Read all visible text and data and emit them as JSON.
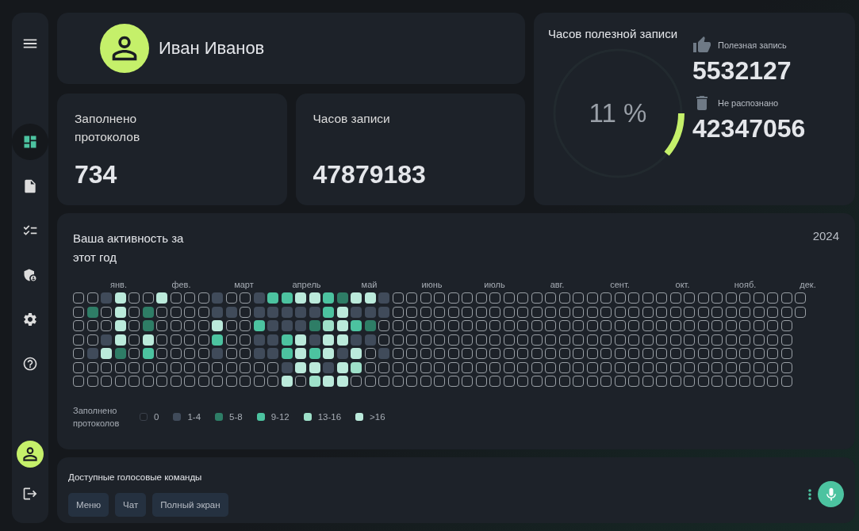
{
  "sidebar": {
    "items": [
      {
        "selected": true
      },
      {
        "selected": false
      },
      {
        "selected": false
      },
      {
        "selected": false
      },
      {
        "selected": false
      },
      {
        "selected": false
      }
    ]
  },
  "profile": {
    "name": "Иван Иванов"
  },
  "stats": [
    {
      "label": "Заполнено протоколов",
      "value": "734"
    },
    {
      "label": "Часов записи",
      "value": "47879183"
    }
  ],
  "useful": {
    "title": "Часов полезной записи",
    "level": 0.11,
    "percent": "11 %",
    "items": [
      {
        "kind": "useful",
        "label": "Полезная запись",
        "value": "5532127"
      },
      {
        "kind": "unrecognized",
        "label": "Не распознано",
        "value": "42347056"
      }
    ]
  },
  "activity": {
    "title": "Ваша активность за этот год",
    "year": "2024",
    "months": [
      "янв.",
      "фев.",
      "март",
      "апрель",
      "май",
      "июнь",
      "июль",
      "авг.",
      "сент.",
      "окт.",
      "нояб.",
      "дек."
    ],
    "rows": [
      [
        {
          "color": "#1b1f25"
        },
        {
          "color": "#1b1f25"
        },
        {
          "color": "#404b5a"
        },
        {
          "color": "#bbeadb"
        },
        {
          "color": "#1b1f25"
        },
        {
          "color": "#1b1f25"
        },
        {
          "color": "#bbeadb"
        },
        {
          "color": "#1b1f25"
        },
        {
          "color": "#1b1f25"
        },
        {
          "color": "#1b1f25"
        },
        {
          "color": "#404b5a"
        },
        {
          "color": "#1b1f25"
        },
        {
          "color": "#1b1f25"
        },
        {
          "color": "#404b5a"
        },
        {
          "color": "#4cc3a0"
        },
        {
          "color": "#4cc3a0"
        },
        {
          "color": "#bbeadb"
        },
        {
          "color": "#bbeadb"
        },
        {
          "color": "#4cc3a0"
        },
        {
          "color": "#2e7d66"
        },
        {
          "color": "#bbeadb"
        },
        {
          "color": "#bbeadb"
        },
        {
          "color": "#404b5a"
        },
        {
          "color": "#1b1f25"
        },
        {
          "color": "#1b1f25"
        },
        {
          "color": "#1b1f25"
        },
        {
          "color": "#1b1f25"
        },
        {
          "color": "#1b1f25"
        },
        {
          "color": "#1b1f25"
        },
        {
          "color": "#1b1f25"
        },
        {
          "color": "#1b1f25"
        },
        {
          "color": "#1b1f25"
        },
        {
          "color": "#1b1f25"
        },
        {
          "color": "#1b1f25"
        },
        {
          "color": "#1b1f25"
        },
        {
          "color": "#1b1f25"
        },
        {
          "color": "#1b1f25"
        },
        {
          "color": "#1b1f25"
        },
        {
          "color": "#1b1f25"
        },
        {
          "color": "#1b1f25"
        },
        {
          "color": "#1b1f25"
        },
        {
          "color": "#1b1f25"
        },
        {
          "color": "#1b1f25"
        },
        {
          "color": "#1b1f25"
        },
        {
          "color": "#1b1f25"
        },
        {
          "color": "#1b1f25"
        },
        {
          "color": "#1b1f25"
        },
        {
          "color": "#1b1f25"
        },
        {
          "color": "#1b1f25"
        },
        {
          "color": "#1b1f25"
        },
        {
          "color": "#1b1f25"
        },
        {
          "color": "#1b1f25"
        },
        {
          "color": "#1b1f25"
        }
      ],
      [
        {
          "color": "#1b1f25"
        },
        {
          "color": "#2e7d66"
        },
        {
          "color": "#1b1f25"
        },
        {
          "color": "#bbeadb"
        },
        {
          "color": "#1b1f25"
        },
        {
          "color": "#2e7d66"
        },
        {
          "color": "#1b1f25"
        },
        {
          "color": "#1b1f25"
        },
        {
          "color": "#1b1f25"
        },
        {
          "color": "#1b1f25"
        },
        {
          "color": "#404b5a"
        },
        {
          "color": "#404b5a"
        },
        {
          "color": "#1b1f25"
        },
        {
          "color": "#404b5a"
        },
        {
          "color": "#404b5a"
        },
        {
          "color": "#404b5a"
        },
        {
          "color": "#404b5a"
        },
        {
          "color": "#404b5a"
        },
        {
          "color": "#4cc3a0"
        },
        {
          "color": "#bbeadb"
        },
        {
          "color": "#404b5a"
        },
        {
          "color": "#404b5a"
        },
        {
          "color": "#404b5a"
        },
        {
          "color": "#1b1f25"
        },
        {
          "color": "#1b1f25"
        },
        {
          "color": "#1b1f25"
        },
        {
          "color": "#1b1f25"
        },
        {
          "color": "#1b1f25"
        },
        {
          "color": "#1b1f25"
        },
        {
          "color": "#1b1f25"
        },
        {
          "color": "#1b1f25"
        },
        {
          "color": "#1b1f25"
        },
        {
          "color": "#1b1f25"
        },
        {
          "color": "#1b1f25"
        },
        {
          "color": "#1b1f25"
        },
        {
          "color": "#1b1f25"
        },
        {
          "color": "#1b1f25"
        },
        {
          "color": "#1b1f25"
        },
        {
          "color": "#1b1f25"
        },
        {
          "color": "#1b1f25"
        },
        {
          "color": "#1b1f25"
        },
        {
          "color": "#1b1f25"
        },
        {
          "color": "#1b1f25"
        },
        {
          "color": "#1b1f25"
        },
        {
          "color": "#1b1f25"
        },
        {
          "color": "#1b1f25"
        },
        {
          "color": "#1b1f25"
        },
        {
          "color": "#1b1f25"
        },
        {
          "color": "#1b1f25"
        },
        {
          "color": "#1b1f25"
        },
        {
          "color": "#1b1f25"
        },
        {
          "color": "#1b1f25"
        },
        {
          "color": "#1b1f25"
        }
      ],
      [
        {
          "color": "#1b1f25"
        },
        {
          "color": "#1b1f25"
        },
        {
          "color": "#1b1f25"
        },
        {
          "color": "#bbeadb"
        },
        {
          "color": "#1b1f25"
        },
        {
          "color": "#2e7d66"
        },
        {
          "color": "#1b1f25"
        },
        {
          "color": "#1b1f25"
        },
        {
          "color": "#1b1f25"
        },
        {
          "color": "#1b1f25"
        },
        {
          "color": "#bbeadb"
        },
        {
          "color": "#1b1f25"
        },
        {
          "color": "#1b1f25"
        },
        {
          "color": "#4cc3a0"
        },
        {
          "color": "#404b5a"
        },
        {
          "color": "#404b5a"
        },
        {
          "color": "#404b5a"
        },
        {
          "color": "#2e7d66"
        },
        {
          "color": "#9ee0c9"
        },
        {
          "color": "#bbeadb"
        },
        {
          "color": "#4cc3a0"
        },
        {
          "color": "#2e7d66"
        },
        {
          "color": "#1b1f25"
        },
        {
          "color": "#1b1f25"
        },
        {
          "color": "#1b1f25"
        },
        {
          "color": "#1b1f25"
        },
        {
          "color": "#1b1f25"
        },
        {
          "color": "#1b1f25"
        },
        {
          "color": "#1b1f25"
        },
        {
          "color": "#1b1f25"
        },
        {
          "color": "#1b1f25"
        },
        {
          "color": "#1b1f25"
        },
        {
          "color": "#1b1f25"
        },
        {
          "color": "#1b1f25"
        },
        {
          "color": "#1b1f25"
        },
        {
          "color": "#1b1f25"
        },
        {
          "color": "#1b1f25"
        },
        {
          "color": "#1b1f25"
        },
        {
          "color": "#1b1f25"
        },
        {
          "color": "#1b1f25"
        },
        {
          "color": "#1b1f25"
        },
        {
          "color": "#1b1f25"
        },
        {
          "color": "#1b1f25"
        },
        {
          "color": "#1b1f25"
        },
        {
          "color": "#1b1f25"
        },
        {
          "color": "#1b1f25"
        },
        {
          "color": "#1b1f25"
        },
        {
          "color": "#1b1f25"
        },
        {
          "color": "#1b1f25"
        },
        {
          "color": "#1b1f25"
        },
        {
          "color": "#1b1f25"
        },
        {
          "color": "#1b1f25"
        }
      ],
      [
        {
          "color": "#1b1f25"
        },
        {
          "color": "#1b1f25"
        },
        {
          "color": "#404b5a"
        },
        {
          "color": "#bbeadb"
        },
        {
          "color": "#1b1f25"
        },
        {
          "color": "#bbeadb"
        },
        {
          "color": "#1b1f25"
        },
        {
          "color": "#1b1f25"
        },
        {
          "color": "#1b1f25"
        },
        {
          "color": "#1b1f25"
        },
        {
          "color": "#4cc3a0"
        },
        {
          "color": "#1b1f25"
        },
        {
          "color": "#1b1f25"
        },
        {
          "color": "#404b5a"
        },
        {
          "color": "#404b5a"
        },
        {
          "color": "#4cc3a0"
        },
        {
          "color": "#bbeadb"
        },
        {
          "color": "#404b5a"
        },
        {
          "color": "#bbeadb"
        },
        {
          "color": "#bbeadb"
        },
        {
          "color": "#404b5a"
        },
        {
          "color": "#404b5a"
        },
        {
          "color": "#1b1f25"
        },
        {
          "color": "#1b1f25"
        },
        {
          "color": "#1b1f25"
        },
        {
          "color": "#1b1f25"
        },
        {
          "color": "#1b1f25"
        },
        {
          "color": "#1b1f25"
        },
        {
          "color": "#1b1f25"
        },
        {
          "color": "#1b1f25"
        },
        {
          "color": "#1b1f25"
        },
        {
          "color": "#1b1f25"
        },
        {
          "color": "#1b1f25"
        },
        {
          "color": "#1b1f25"
        },
        {
          "color": "#1b1f25"
        },
        {
          "color": "#1b1f25"
        },
        {
          "color": "#1b1f25"
        },
        {
          "color": "#1b1f25"
        },
        {
          "color": "#1b1f25"
        },
        {
          "color": "#1b1f25"
        },
        {
          "color": "#1b1f25"
        },
        {
          "color": "#1b1f25"
        },
        {
          "color": "#1b1f25"
        },
        {
          "color": "#1b1f25"
        },
        {
          "color": "#1b1f25"
        },
        {
          "color": "#1b1f25"
        },
        {
          "color": "#1b1f25"
        },
        {
          "color": "#1b1f25"
        },
        {
          "color": "#1b1f25"
        },
        {
          "color": "#1b1f25"
        },
        {
          "color": "#1b1f25"
        },
        {
          "color": "#1b1f25"
        }
      ],
      [
        {
          "color": "#1b1f25"
        },
        {
          "color": "#404b5a"
        },
        {
          "color": "#bbeadb"
        },
        {
          "color": "#2e7d66"
        },
        {
          "color": "#1b1f25"
        },
        {
          "color": "#4cc3a0"
        },
        {
          "color": "#1b1f25"
        },
        {
          "color": "#1b1f25"
        },
        {
          "color": "#1b1f25"
        },
        {
          "color": "#1b1f25"
        },
        {
          "color": "#404b5a"
        },
        {
          "color": "#1b1f25"
        },
        {
          "color": "#1b1f25"
        },
        {
          "color": "#404b5a"
        },
        {
          "color": "#404b5a"
        },
        {
          "color": "#4cc3a0"
        },
        {
          "color": "#bbeadb"
        },
        {
          "color": "#4cc3a0"
        },
        {
          "color": "#bbeadb"
        },
        {
          "color": "#404b5a"
        },
        {
          "color": "#bbeadb"
        },
        {
          "color": "#1b1f25"
        },
        {
          "color": "#404b5a"
        },
        {
          "color": "#1b1f25"
        },
        {
          "color": "#1b1f25"
        },
        {
          "color": "#1b1f25"
        },
        {
          "color": "#1b1f25"
        },
        {
          "color": "#1b1f25"
        },
        {
          "color": "#1b1f25"
        },
        {
          "color": "#1b1f25"
        },
        {
          "color": "#1b1f25"
        },
        {
          "color": "#1b1f25"
        },
        {
          "color": "#1b1f25"
        },
        {
          "color": "#1b1f25"
        },
        {
          "color": "#1b1f25"
        },
        {
          "color": "#1b1f25"
        },
        {
          "color": "#1b1f25"
        },
        {
          "color": "#1b1f25"
        },
        {
          "color": "#1b1f25"
        },
        {
          "color": "#1b1f25"
        },
        {
          "color": "#1b1f25"
        },
        {
          "color": "#1b1f25"
        },
        {
          "color": "#1b1f25"
        },
        {
          "color": "#1b1f25"
        },
        {
          "color": "#1b1f25"
        },
        {
          "color": "#1b1f25"
        },
        {
          "color": "#1b1f25"
        },
        {
          "color": "#1b1f25"
        },
        {
          "color": "#1b1f25"
        },
        {
          "color": "#1b1f25"
        },
        {
          "color": "#1b1f25"
        },
        {
          "color": "#1b1f25"
        }
      ],
      [
        {
          "color": "#1b1f25"
        },
        {
          "color": "#1b1f25"
        },
        {
          "color": "#1b1f25"
        },
        {
          "color": "#1b1f25"
        },
        {
          "color": "#1b1f25"
        },
        {
          "color": "#1b1f25"
        },
        {
          "color": "#1b1f25"
        },
        {
          "color": "#1b1f25"
        },
        {
          "color": "#1b1f25"
        },
        {
          "color": "#1b1f25"
        },
        {
          "color": "#1b1f25"
        },
        {
          "color": "#1b1f25"
        },
        {
          "color": "#1b1f25"
        },
        {
          "color": "#1b1f25"
        },
        {
          "color": "#1b1f25"
        },
        {
          "color": "#404b5a"
        },
        {
          "color": "#bbeadb"
        },
        {
          "color": "#bbeadb"
        },
        {
          "color": "#404b5a"
        },
        {
          "color": "#bbeadb"
        },
        {
          "color": "#9ee0c9"
        },
        {
          "color": "#1b1f25"
        },
        {
          "color": "#1b1f25"
        },
        {
          "color": "#1b1f25"
        },
        {
          "color": "#1b1f25"
        },
        {
          "color": "#1b1f25"
        },
        {
          "color": "#1b1f25"
        },
        {
          "color": "#1b1f25"
        },
        {
          "color": "#1b1f25"
        },
        {
          "color": "#1b1f25"
        },
        {
          "color": "#1b1f25"
        },
        {
          "color": "#1b1f25"
        },
        {
          "color": "#1b1f25"
        },
        {
          "color": "#1b1f25"
        },
        {
          "color": "#1b1f25"
        },
        {
          "color": "#1b1f25"
        },
        {
          "color": "#1b1f25"
        },
        {
          "color": "#1b1f25"
        },
        {
          "color": "#1b1f25"
        },
        {
          "color": "#1b1f25"
        },
        {
          "color": "#1b1f25"
        },
        {
          "color": "#1b1f25"
        },
        {
          "color": "#1b1f25"
        },
        {
          "color": "#1b1f25"
        },
        {
          "color": "#1b1f25"
        },
        {
          "color": "#1b1f25"
        },
        {
          "color": "#1b1f25"
        },
        {
          "color": "#1b1f25"
        },
        {
          "color": "#1b1f25"
        },
        {
          "color": "#1b1f25"
        },
        {
          "color": "#1b1f25"
        },
        {
          "color": "#1b1f25"
        }
      ],
      [
        {
          "color": "#1b1f25"
        },
        {
          "color": "#1b1f25"
        },
        {
          "color": "#1b1f25"
        },
        {
          "color": "#1b1f25"
        },
        {
          "color": "#1b1f25"
        },
        {
          "color": "#1b1f25"
        },
        {
          "color": "#1b1f25"
        },
        {
          "color": "#1b1f25"
        },
        {
          "color": "#1b1f25"
        },
        {
          "color": "#1b1f25"
        },
        {
          "color": "#1b1f25"
        },
        {
          "color": "#1b1f25"
        },
        {
          "color": "#1b1f25"
        },
        {
          "color": "#1b1f25"
        },
        {
          "color": "#1b1f25"
        },
        {
          "color": "#bbeadb"
        },
        {
          "color": "#1b1f25"
        },
        {
          "color": "#9ee0c9"
        },
        {
          "color": "#bbeadb"
        },
        {
          "color": "#bbeadb"
        },
        {
          "color": "#1b1f25"
        },
        {
          "color": "#1b1f25"
        },
        {
          "color": "#1b1f25"
        },
        {
          "color": "#1b1f25"
        },
        {
          "color": "#1b1f25"
        },
        {
          "color": "#1b1f25"
        },
        {
          "color": "#1b1f25"
        },
        {
          "color": "#1b1f25"
        },
        {
          "color": "#1b1f25"
        },
        {
          "color": "#1b1f25"
        },
        {
          "color": "#1b1f25"
        },
        {
          "color": "#1b1f25"
        },
        {
          "color": "#1b1f25"
        },
        {
          "color": "#1b1f25"
        },
        {
          "color": "#1b1f25"
        },
        {
          "color": "#1b1f25"
        },
        {
          "color": "#1b1f25"
        },
        {
          "color": "#1b1f25"
        },
        {
          "color": "#1b1f25"
        },
        {
          "color": "#1b1f25"
        },
        {
          "color": "#1b1f25"
        },
        {
          "color": "#1b1f25"
        },
        {
          "color": "#1b1f25"
        },
        {
          "color": "#1b1f25"
        },
        {
          "color": "#1b1f25"
        },
        {
          "color": "#1b1f25"
        },
        {
          "color": "#1b1f25"
        },
        {
          "color": "#1b1f25"
        },
        {
          "color": "#1b1f25"
        },
        {
          "color": "#1b1f25"
        },
        {
          "color": "#1b1f25"
        },
        {
          "color": "#1b1f25"
        }
      ]
    ],
    "legend": {
      "title": "Заполнено протоколов",
      "items": [
        {
          "kind": "outline",
          "label": "0",
          "color": "#1b1f25"
        },
        {
          "kind": "fill",
          "label": "1-4",
          "color": "#404b5a"
        },
        {
          "kind": "fill",
          "label": "5-8",
          "color": "#2e7d66"
        },
        {
          "kind": "fill",
          "label": "9-12",
          "color": "#4cc3a0"
        },
        {
          "kind": "fill",
          "label": "13-16",
          "color": "#9ee0c9"
        },
        {
          "kind": "fill",
          "label": ">16",
          "color": "#bbeadb"
        }
      ]
    }
  },
  "voice": {
    "title": "Доступные голосовые команды",
    "commands": [
      "Меню",
      "Чат",
      "Полный экран"
    ]
  }
}
